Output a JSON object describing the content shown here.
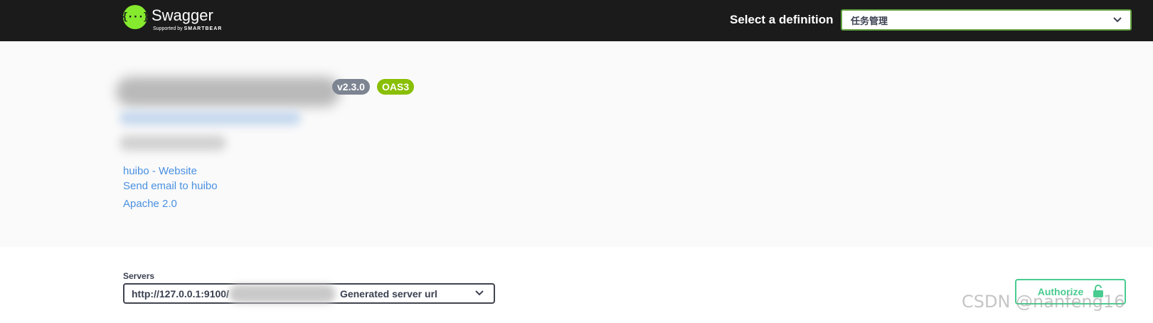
{
  "topbar": {
    "logo_title": "Swagger",
    "logo_supported": "Supported by",
    "logo_brand": "SMARTBEAR",
    "logo_mark": "{···}",
    "definition_label": "Select a definition",
    "definition_value": "任务管理"
  },
  "info": {
    "version_badge": "v2.3.0",
    "oas_badge": "OAS3",
    "links": {
      "website": "huibo - Website",
      "email": "Send email to huibo",
      "license": "Apache 2.0"
    }
  },
  "servers": {
    "label": "Servers",
    "url_prefix": "http://127.0.0.1:9100/",
    "url_suffix": "Generated server url"
  },
  "authorize": {
    "label": "Authorize"
  },
  "watermark": "CSDN @nanfeng16",
  "colors": {
    "topbar_bg": "#1b1b1b",
    "accent_green": "#49cc90",
    "select_border": "#62a03f",
    "link_blue": "#4990e2",
    "badge_grey": "#7d8492",
    "badge_green": "#89bf04"
  }
}
